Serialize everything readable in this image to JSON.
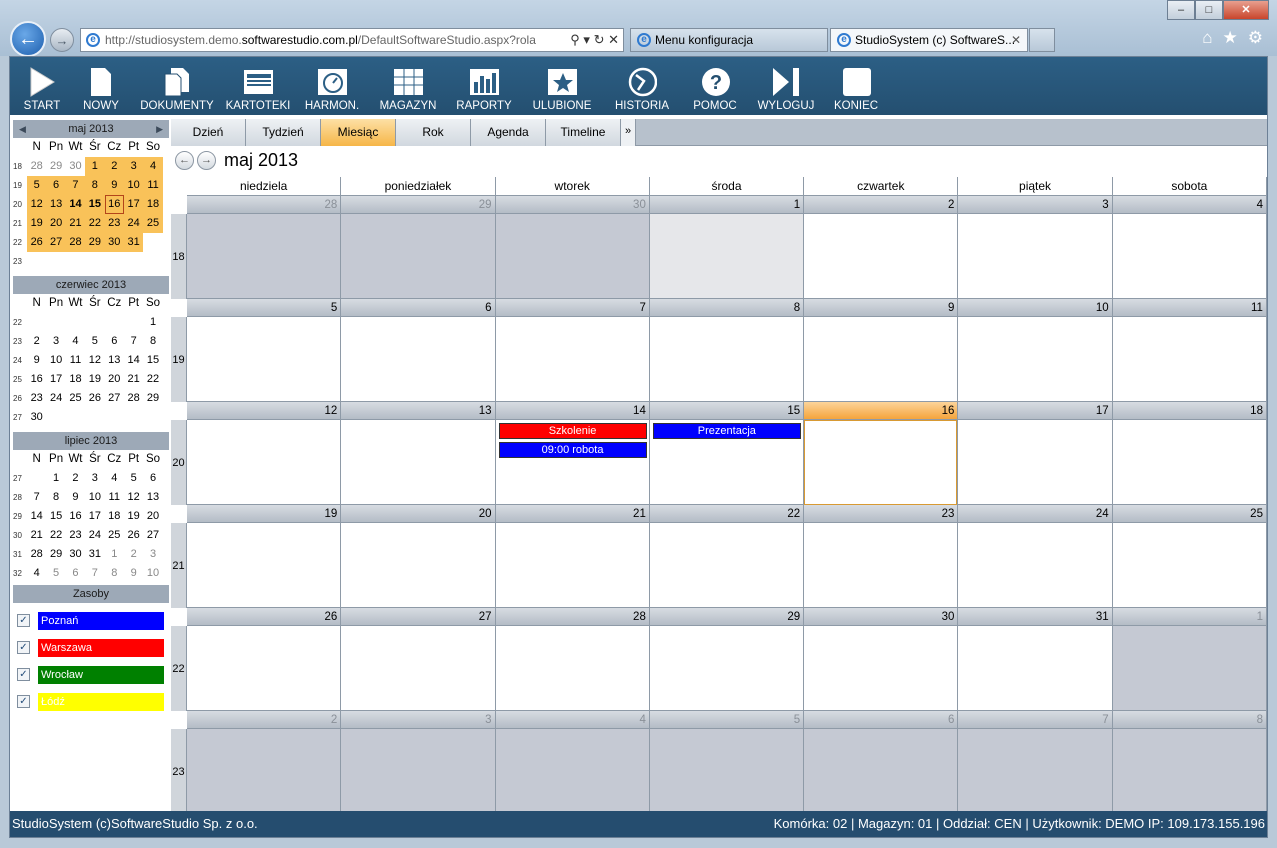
{
  "browser": {
    "url_prefix": "http://studiosystem.demo.",
    "url_host": "softwarestudio.com.pl",
    "url_rest": "/DefaultSoftwareStudio.aspx?rola",
    "tabs": [
      "Menu konfiguracja",
      "StudioSystem (c) SoftwareS..."
    ],
    "min": "–",
    "max": "□",
    "close": "✕"
  },
  "toolbar": [
    "START",
    "NOWY",
    "DOKUMENTY",
    "KARTOTEKI",
    "HARMON.",
    "MAGAZYN",
    "RAPORTY",
    "ULUBIONE",
    "HISTORIA",
    "POMOC",
    "WYLOGUJ",
    "KONIEC"
  ],
  "mini_cals": [
    {
      "title": "maj 2013",
      "days": [
        "N",
        "Pn",
        "Wt",
        "Śr",
        "Cz",
        "Pt",
        "So"
      ],
      "weeks": [
        {
          "wk": "18",
          "d": [
            "28",
            "29",
            "30",
            "1",
            "2",
            "3",
            "4"
          ]
        },
        {
          "wk": "19",
          "d": [
            "5",
            "6",
            "7",
            "8",
            "9",
            "10",
            "11"
          ]
        },
        {
          "wk": "20",
          "d": [
            "12",
            "13",
            "14",
            "15",
            "16",
            "17",
            "18"
          ]
        },
        {
          "wk": "21",
          "d": [
            "19",
            "20",
            "21",
            "22",
            "23",
            "24",
            "25"
          ]
        },
        {
          "wk": "22",
          "d": [
            "26",
            "27",
            "28",
            "29",
            "30",
            "31",
            ""
          ]
        },
        {
          "wk": "23",
          "d": [
            "",
            "",
            "",
            "",
            "",
            "",
            ""
          ]
        }
      ]
    },
    {
      "title": "czerwiec 2013",
      "days": [
        "N",
        "Pn",
        "Wt",
        "Śr",
        "Cz",
        "Pt",
        "So"
      ],
      "weeks": [
        {
          "wk": "22",
          "d": [
            "",
            "",
            "",
            "",
            "",
            "",
            "1"
          ]
        },
        {
          "wk": "23",
          "d": [
            "2",
            "3",
            "4",
            "5",
            "6",
            "7",
            "8"
          ]
        },
        {
          "wk": "24",
          "d": [
            "9",
            "10",
            "11",
            "12",
            "13",
            "14",
            "15"
          ]
        },
        {
          "wk": "25",
          "d": [
            "16",
            "17",
            "18",
            "19",
            "20",
            "21",
            "22"
          ]
        },
        {
          "wk": "26",
          "d": [
            "23",
            "24",
            "25",
            "26",
            "27",
            "28",
            "29"
          ]
        },
        {
          "wk": "27",
          "d": [
            "30",
            "",
            "",
            "",
            "",
            "",
            ""
          ]
        }
      ]
    },
    {
      "title": "lipiec 2013",
      "days": [
        "N",
        "Pn",
        "Wt",
        "Śr",
        "Cz",
        "Pt",
        "So"
      ],
      "weeks": [
        {
          "wk": "27",
          "d": [
            "",
            "1",
            "2",
            "3",
            "4",
            "5",
            "6"
          ]
        },
        {
          "wk": "28",
          "d": [
            "7",
            "8",
            "9",
            "10",
            "11",
            "12",
            "13"
          ]
        },
        {
          "wk": "29",
          "d": [
            "14",
            "15",
            "16",
            "17",
            "18",
            "19",
            "20"
          ]
        },
        {
          "wk": "30",
          "d": [
            "21",
            "22",
            "23",
            "24",
            "25",
            "26",
            "27"
          ]
        },
        {
          "wk": "31",
          "d": [
            "28",
            "29",
            "30",
            "31",
            "1",
            "2",
            "3"
          ]
        },
        {
          "wk": "32",
          "d": [
            "4",
            "5",
            "6",
            "7",
            "8",
            "9",
            "10"
          ]
        }
      ]
    }
  ],
  "resources": {
    "title": "Zasoby",
    "items": [
      {
        "name": "Poznań",
        "color": "#0000ff"
      },
      {
        "name": "Warszawa",
        "color": "#ff0000"
      },
      {
        "name": "Wrocław",
        "color": "#008000"
      },
      {
        "name": "Łódź",
        "color": "#ffff00"
      }
    ]
  },
  "views": [
    "Dzień",
    "Tydzień",
    "Miesiąc",
    "Rok",
    "Agenda",
    "Timeline"
  ],
  "active_view": "Miesiąc",
  "month_title": "maj 2013",
  "weekdays": [
    "niedziela",
    "poniedziałek",
    "wtorek",
    "środa",
    "czwartek",
    "piątek",
    "sobota"
  ],
  "weeks": [
    {
      "wk": "18",
      "d": [
        "28",
        "29",
        "30",
        "1",
        "2",
        "3",
        "4"
      ]
    },
    {
      "wk": "19",
      "d": [
        "5",
        "6",
        "7",
        "8",
        "9",
        "10",
        "11"
      ]
    },
    {
      "wk": "20",
      "d": [
        "12",
        "13",
        "14",
        "15",
        "16",
        "17",
        "18"
      ]
    },
    {
      "wk": "21",
      "d": [
        "19",
        "20",
        "21",
        "22",
        "23",
        "24",
        "25"
      ]
    },
    {
      "wk": "22",
      "d": [
        "26",
        "27",
        "28",
        "29",
        "30",
        "31",
        "1"
      ]
    },
    {
      "wk": "23",
      "d": [
        "2",
        "3",
        "4",
        "5",
        "6",
        "7",
        "8"
      ]
    }
  ],
  "events": [
    {
      "week": 2,
      "day": 2,
      "row": 0,
      "title": "Szkolenie",
      "color": "#ff0000"
    },
    {
      "week": 2,
      "day": 2,
      "row": 1,
      "title": "09:00 robota",
      "color": "#0000ff"
    },
    {
      "week": 2,
      "day": 3,
      "row": 0,
      "title": "Prezentacja",
      "color": "#0000ff"
    }
  ],
  "status": {
    "left": "StudioSystem (c)SoftwareStudio Sp. z o.o.",
    "right": "Komórka: 02 | Magazyn: 01 | Oddział: CEN | Użytkownik: DEMO IP: 109.173.155.196"
  }
}
